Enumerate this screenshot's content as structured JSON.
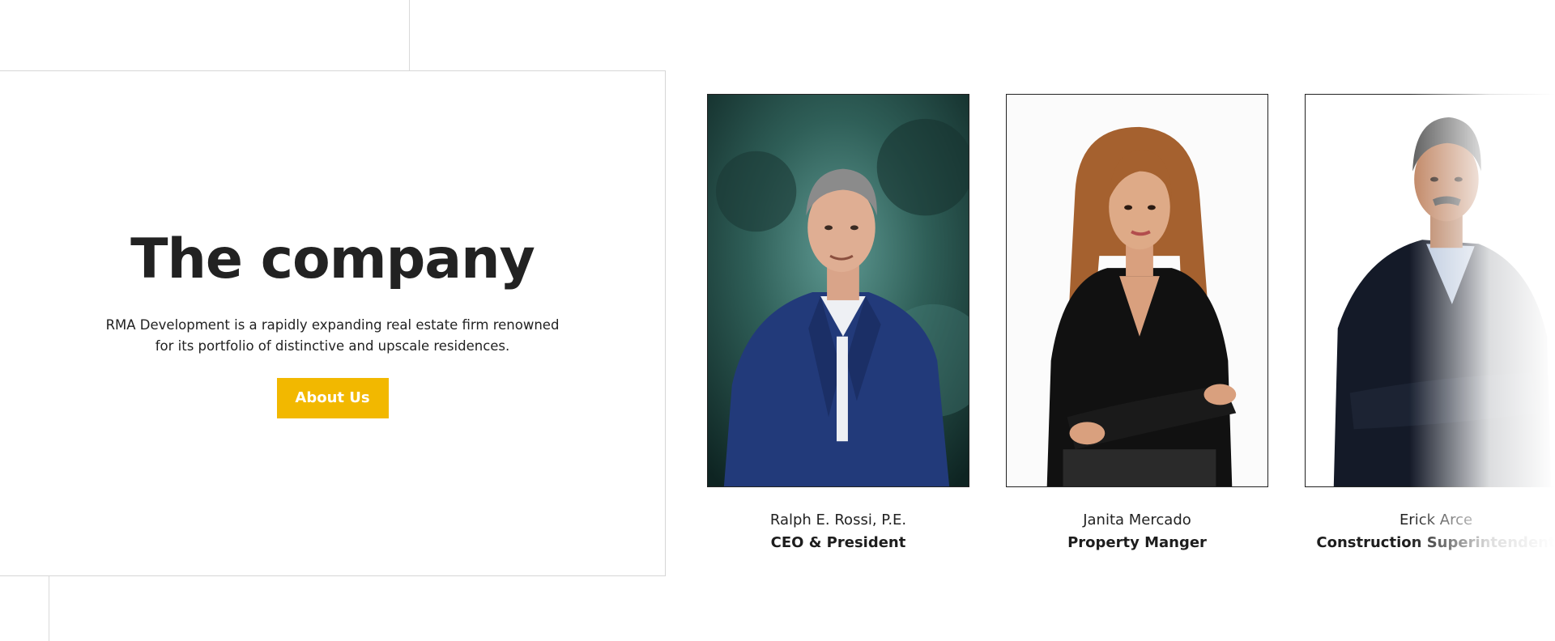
{
  "intro": {
    "title": "The company",
    "description": "RMA Development is a rapidly expanding real estate firm renowned for its portfolio of distinctive and upscale residences.",
    "button_label": "About Us"
  },
  "team": [
    {
      "name": "Ralph E. Rossi, P.E.",
      "role": "CEO & President"
    },
    {
      "name": "Janita Mercado",
      "role": "Property Manger"
    },
    {
      "name": "Erick Arce",
      "role": "Construction Superintendent"
    }
  ],
  "colors": {
    "accent": "#f2b800",
    "text": "#222222",
    "border": "#d6d6d6"
  }
}
